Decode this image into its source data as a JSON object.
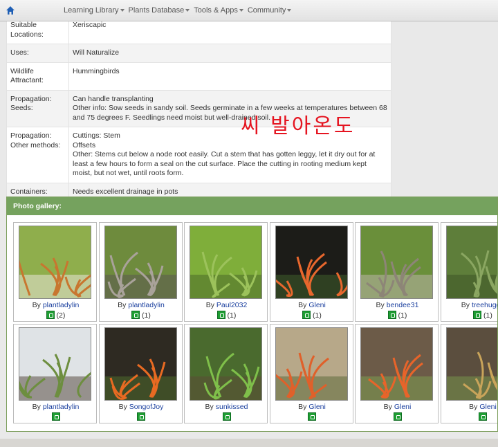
{
  "nav": {
    "items": [
      "Learning Library",
      "Plants Database",
      "Tools & Apps",
      "Community"
    ]
  },
  "attributes": [
    {
      "key": "Suitable Locations:",
      "value": [
        "Xeriscapic"
      ]
    },
    {
      "key": "Uses:",
      "value": [
        "Will Naturalize"
      ]
    },
    {
      "key": "Wildlife Attractant:",
      "value": [
        "Hummingbirds"
      ]
    },
    {
      "key": "Propagation: Seeds:",
      "value": [
        "Can handle transplanting",
        "Other info: Sow seeds in sandy soil. Seeds germinate in a few weeks at temperatures between 68 and 75 degrees F. Seedlings need moist but well-drained soil."
      ]
    },
    {
      "key": "Propagation: Other methods:",
      "value": [
        "Cuttings: Stem",
        "Offsets",
        "Other: Stems cut below a node root easily. Cut a stem that has gotten leggy, let it dry out for at least a few hours to form a seal on the cut surface. Place the cutting in rooting medium kept moist, but not wet, until roots form."
      ]
    },
    {
      "key": "Containers:",
      "value": [
        "Needs excellent drainage in pots"
      ]
    }
  ],
  "overlay_text": "씨 발아온도",
  "gallery": {
    "title": "Photo gallery:",
    "by_label": "By",
    "photos": [
      {
        "user": "plantladylin",
        "votes": "(2)"
      },
      {
        "user": "plantladylin",
        "votes": "(1)"
      },
      {
        "user": "Paul2032",
        "votes": "(1)"
      },
      {
        "user": "Gleni",
        "votes": "(1)"
      },
      {
        "user": "bendee31",
        "votes": "(1)"
      },
      {
        "user": "treehugge",
        "votes": "(1)"
      },
      {
        "user": "plantladylin",
        "votes": ""
      },
      {
        "user": "SongofJoy",
        "votes": ""
      },
      {
        "user": "sunkissed",
        "votes": ""
      },
      {
        "user": "Gleni",
        "votes": ""
      },
      {
        "user": "Gleni",
        "votes": ""
      },
      {
        "user": "Gleni",
        "votes": ""
      }
    ]
  },
  "colors": {
    "gallery_header": "#75a25e",
    "link": "#1a3f9e",
    "overlay_text": "#e51420",
    "thumbs_up": "#1e9e33"
  }
}
